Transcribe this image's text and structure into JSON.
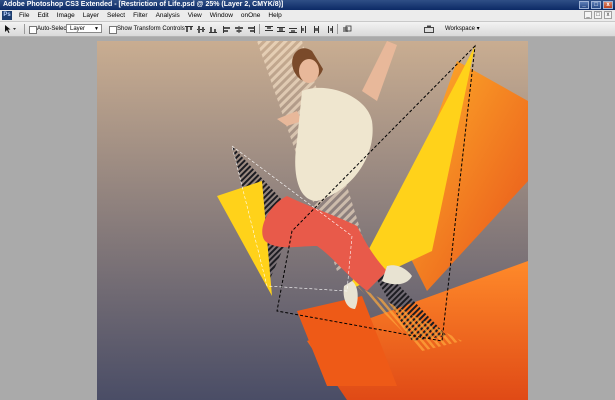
{
  "window": {
    "title": "Adobe Photoshop CS3 Extended - [Restriction of Life.psd @ 25% (Layer 2, CMYK/8)]",
    "app_icon": "Ps",
    "controls": [
      "_",
      "□",
      "x"
    ]
  },
  "menubar": {
    "items": [
      "File",
      "Edit",
      "Image",
      "Layer",
      "Select",
      "Filter",
      "Analysis",
      "View",
      "Window",
      "onOne",
      "Help"
    ],
    "doc_controls": [
      "_",
      "□",
      "x"
    ]
  },
  "options": {
    "auto_select_label": "Auto-Select:",
    "auto_select_value": "Layer",
    "show_transform_label": "Show Transform Controls",
    "workspace_label": "Workspace ▾"
  },
  "canvas": {
    "colors": {
      "bg_top": "#c9ad91",
      "bg_bottom": "#4a4d66",
      "yellow": "#ffd21a",
      "orange": "#f6801c",
      "deep_orange": "#ee5a17",
      "shirt": "#efe6cf",
      "pants": "#e85a4a",
      "shoe": "#e8e3d2",
      "skin": "#e8b89a",
      "hair": "#7a4a2a"
    }
  }
}
